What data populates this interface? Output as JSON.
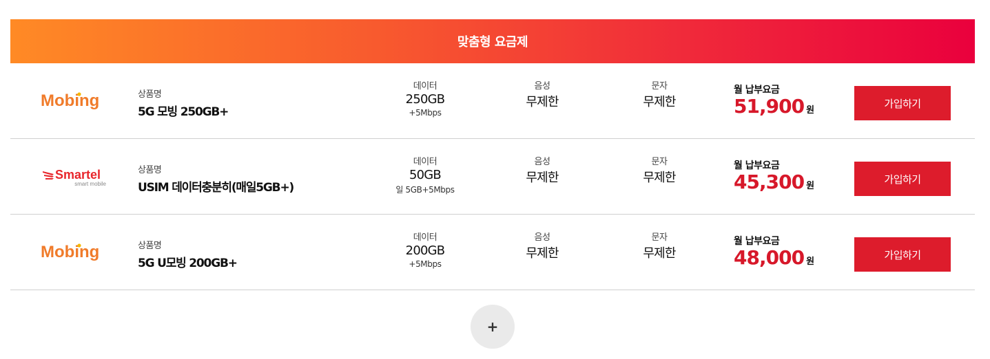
{
  "banner": {
    "title": "맞춤형 요금제"
  },
  "plans": [
    {
      "logo": "Mobing",
      "name_label": "상품명",
      "name": "5G 모빙 250GB+",
      "data_label": "데이터",
      "data": "250GB",
      "data_sub": "+5Mbps",
      "voice_label": "음성",
      "voice": "무제한",
      "sms_label": "문자",
      "sms": "무제한",
      "price_label": "월 납부요금",
      "price": "51,900",
      "price_unit": "원",
      "button": "가입하기"
    },
    {
      "logo": "Smartel",
      "logo_sub": "smart mobile",
      "name_label": "상품명",
      "name": "USIM 데이터충분히(매일5GB+)",
      "data_label": "데이터",
      "data": "50GB",
      "data_sub": "일 5GB+5Mbps",
      "voice_label": "음성",
      "voice": "무제한",
      "sms_label": "문자",
      "sms": "무제한",
      "price_label": "월 납부요금",
      "price": "45,300",
      "price_unit": "원",
      "button": "가입하기"
    },
    {
      "logo": "Mobing",
      "name_label": "상품명",
      "name": "5G U모빙 200GB+",
      "data_label": "데이터",
      "data": "200GB",
      "data_sub": "+5Mbps",
      "voice_label": "음성",
      "voice": "무제한",
      "sms_label": "문자",
      "sms": "무제한",
      "price_label": "월 납부요금",
      "price": "48,000",
      "price_unit": "원",
      "button": "가입하기"
    }
  ],
  "more_button": "+",
  "colors": {
    "accent": "#dd1c2c",
    "price": "#d7182a",
    "banner_start": "#ff8a25",
    "banner_end": "#ea003d",
    "mobing_orange": "#f07b2a",
    "mobing_yellow": "#f5b800",
    "smartel_red": "#e8262b"
  }
}
